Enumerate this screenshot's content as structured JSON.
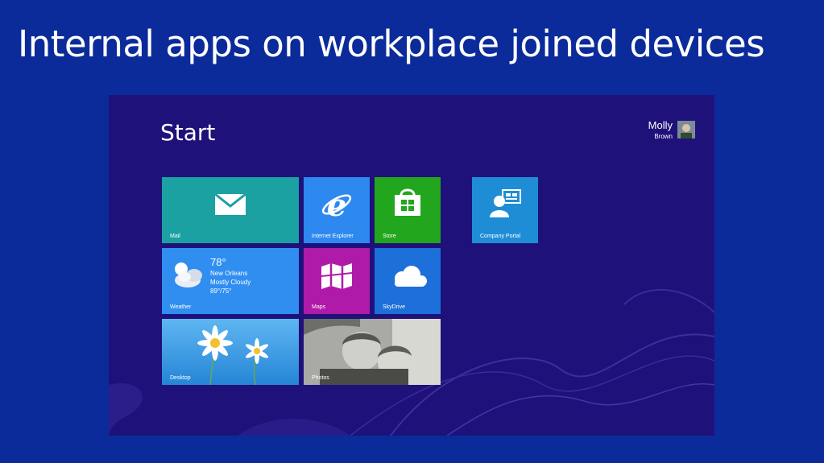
{
  "slide": {
    "title": "Internal apps on workplace joined devices"
  },
  "start": {
    "title": "Start",
    "user": {
      "name": "Molly",
      "subtitle": "Brown"
    },
    "colors": {
      "background": "#1f117a",
      "mail": "#1ba1a2",
      "ie": "#2d89ef",
      "store": "#22a61e",
      "portal": "#1f8dd6",
      "weather": "#2f8ef0",
      "maps": "#b01aa8",
      "skydrive": "#1d6fd9"
    },
    "tiles": {
      "mail": {
        "label": "Mail",
        "icon": "mail-icon"
      },
      "ie": {
        "label": "Internet Explorer",
        "icon": "internet-explorer-icon"
      },
      "store": {
        "label": "Store",
        "icon": "store-icon"
      },
      "portal": {
        "label": "Company Portal",
        "icon": "company-portal-icon"
      },
      "weather": {
        "label": "Weather",
        "icon": "cloud-sun-icon",
        "temp": "78°",
        "city": "New Orleans",
        "condition": "Mostly Cloudy",
        "range": "89°/75°"
      },
      "maps": {
        "label": "Maps",
        "icon": "map-icon"
      },
      "skydrive": {
        "label": "SkyDrive",
        "icon": "cloud-icon"
      },
      "desktop": {
        "label": "Desktop"
      },
      "photos": {
        "label": "Photos"
      }
    }
  }
}
